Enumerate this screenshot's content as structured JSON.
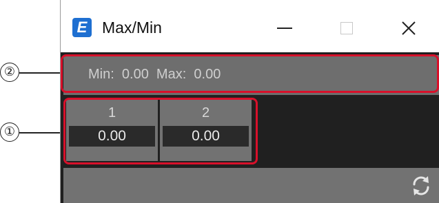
{
  "window": {
    "title": "Max/Min",
    "app_icon_letter": "E",
    "app_icon_color": "#1e6fd1"
  },
  "status_bar": {
    "text": "Min:  0.00  Max:  0.00"
  },
  "channels": [
    {
      "label": "1",
      "value": "0.00"
    },
    {
      "label": "2",
      "value": "0.00"
    }
  ],
  "callouts": {
    "one": "①",
    "two": "②"
  },
  "colors": {
    "highlight": "#d8102a",
    "panel_bg": "#202020",
    "control_bg": "#727272"
  },
  "icons": {
    "minimize": "minimize-icon",
    "maximize": "maximize-icon",
    "close": "close-icon",
    "refresh": "refresh-icon"
  }
}
